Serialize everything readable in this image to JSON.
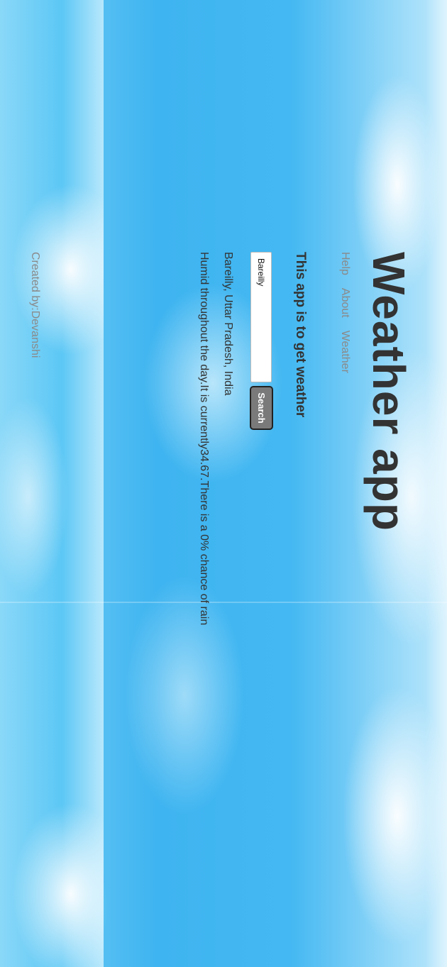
{
  "header": {
    "title": "Weather app",
    "nav": [
      {
        "label": "Help"
      },
      {
        "label": "About"
      },
      {
        "label": "Weather"
      }
    ]
  },
  "main": {
    "subtitle": "This app is to get weather",
    "search": {
      "value": "Bareilly",
      "button_label": "Search"
    },
    "location": "Bareilly, Uttar Pradesh, India",
    "forecast": "Humid throughout the day.It is currently34.67.There is a 0% chance of rain"
  },
  "footer": {
    "text": "Created by:Devanshi"
  },
  "colors": {
    "text": "#333333",
    "muted": "#8a8a8a",
    "button_bg": "#7a7a7a",
    "sky": "#44b8f2"
  }
}
